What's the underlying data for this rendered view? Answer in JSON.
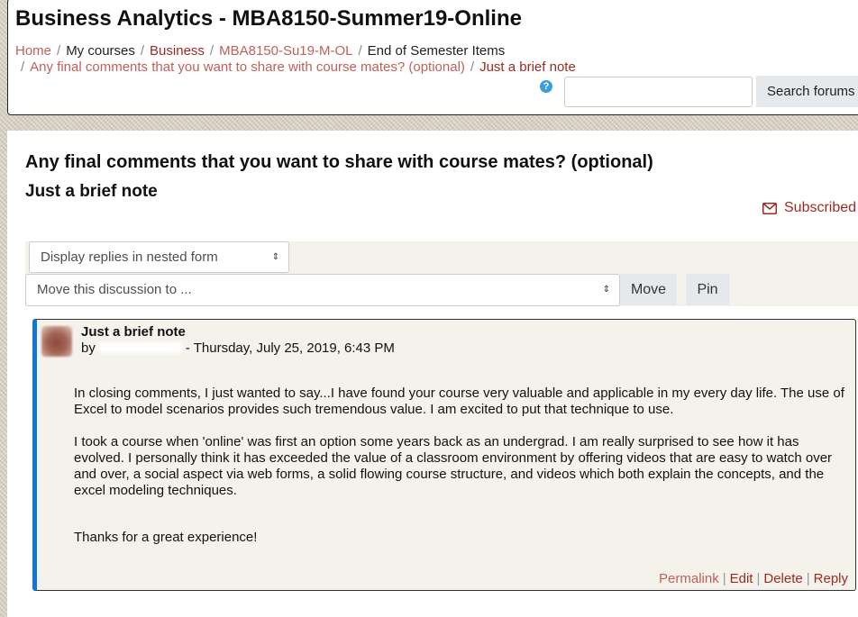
{
  "header": {
    "course_title": "Business Analytics - MBA8150-Summer19-Online",
    "breadcrumb": [
      "Home",
      "My courses",
      "Business",
      "MBA8150-Su19-M-OL",
      "End of Semester Items",
      "Any final comments that you want to share with course mates? (optional)",
      "Just a brief note"
    ],
    "help_icon": "?",
    "search_placeholder": "",
    "search_button": "Search forums"
  },
  "discussion": {
    "title": "Any final comments that you want to share with course mates? (optional)",
    "heading": "Just a brief note",
    "subscribed_label": "Subscribed",
    "display_mode": "Display replies in nested form",
    "move_select": "Move this discussion to ...",
    "move_button": "Move",
    "pin_button": "Pin"
  },
  "post": {
    "subject": "Just a brief note",
    "by_prefix": "by",
    "date_text": "- Thursday, July 25, 2019, 6:43 PM",
    "paragraphs": [
      "In closing comments, I just wanted to say...I have found your course very valuable and applicable in my every day life. The use of Excel to model scenarios provides such tremendous value. I am excited to put that technique to use.",
      "I took a course when 'online' was first an option some years back as an undergrad. I am really surprised to see how it has evolved. I personally think it has exceeded the value of a classroom environment by offering videos that are easy to watch over and over, a social aspect via web forms, a solid flowing course structure, and videos which both explain the concepts, and the excel modeling techniques.",
      "Thanks for a great experience!"
    ],
    "actions": [
      "Permalink",
      "Edit",
      "Delete",
      "Reply"
    ]
  },
  "colors": {
    "link_light": "#c0605a",
    "link_dark": "#9c2a23",
    "post_accent": "#1177d1",
    "help_icon": "#3aa0dc"
  },
  "icons": [
    "help-icon",
    "envelope-icon",
    "chevron-updown-icon",
    "avatar"
  ]
}
